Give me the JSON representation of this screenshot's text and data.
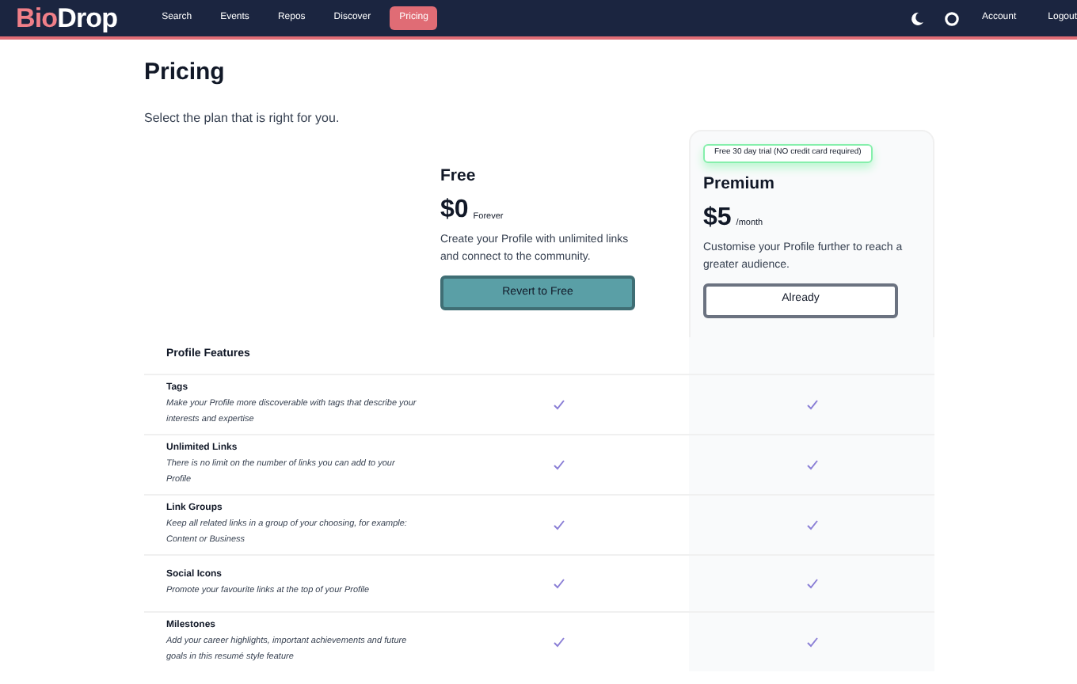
{
  "nav": {
    "logo": {
      "first": "Bio",
      "second": "Drop"
    },
    "links": [
      {
        "label": "Search",
        "selected": false
      },
      {
        "label": "Events",
        "selected": false
      },
      {
        "label": "Repos",
        "selected": false
      },
      {
        "label": "Discover",
        "selected": false
      },
      {
        "label": "Pricing",
        "selected": true
      }
    ],
    "right_links": [
      "Account",
      "Logout"
    ]
  },
  "title": "Pricing",
  "subtitle": "Select the plan that is right for you.",
  "plans": [
    {
      "name": "Free",
      "price": "$0",
      "period": "Forever",
      "description": "Create your Profile with unlimited links and connect to the community.",
      "button": "Revert to Free",
      "highlighted": false
    },
    {
      "name": "Premium",
      "badge": "Free 30 day trial (NO credit card required)",
      "price": "$5",
      "period": "/month",
      "description": "Customise your Profile further to reach a greater audience.",
      "button": "Already",
      "highlighted": true
    }
  ],
  "section_title": "Profile Features",
  "features": [
    {
      "name": "Tags",
      "description": "Make your Profile more discoverable with tags that describe your interests and expertise",
      "included": [
        true,
        true
      ]
    },
    {
      "name": "Unlimited Links",
      "description": "There is no limit on the number of links you can add to your Profile",
      "included": [
        true,
        true
      ]
    },
    {
      "name": "Link Groups",
      "description": "Keep all related links in a group of your choosing, for example: Content or Business",
      "included": [
        true,
        true
      ]
    },
    {
      "name": "Social Icons",
      "description": "Promote your favourite links at the top of your Profile",
      "included": [
        true,
        true
      ]
    },
    {
      "name": "Milestones",
      "description": "Add your career highlights, important achievements and future goals in this resumé style feature",
      "included": [
        true,
        true
      ]
    }
  ]
}
